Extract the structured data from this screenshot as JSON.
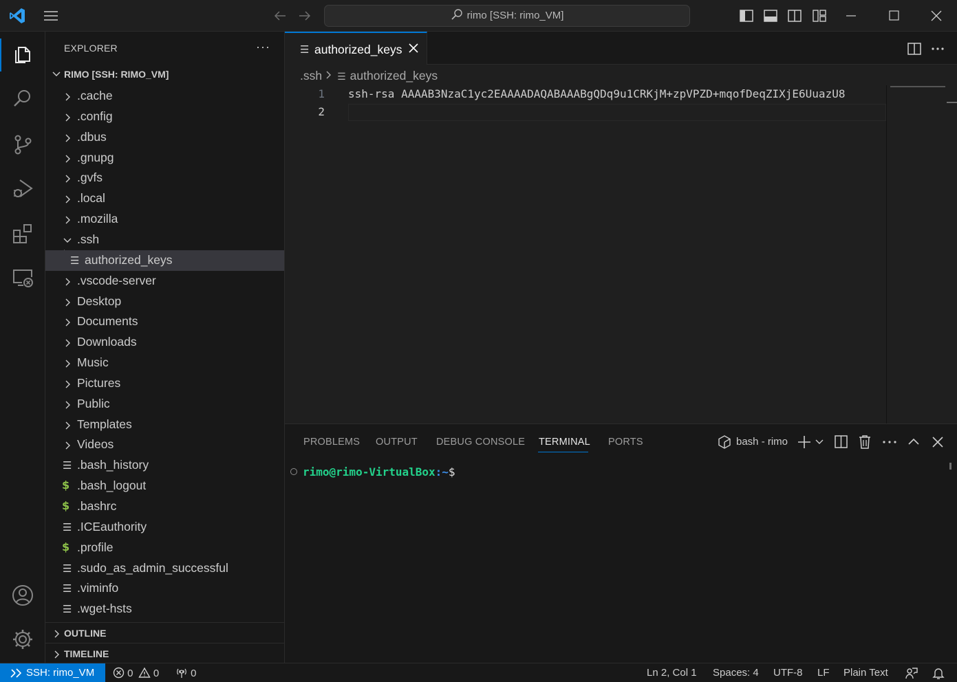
{
  "titlebar": {
    "search_text": "rimo [SSH: rimo_VM]",
    "icons": [
      "vscode-logo-icon",
      "menu-icon",
      "arrow-left-icon",
      "arrow-right-icon",
      "toggle-primary-sidebar-icon",
      "toggle-panel-icon",
      "toggle-secondary-sidebar-icon",
      "customize-layout-icon",
      "minimize-icon",
      "maximize-icon",
      "close-icon"
    ]
  },
  "activitybar": {
    "items": [
      "explorer-icon",
      "search-icon",
      "source-control-icon",
      "run-debug-icon",
      "extensions-icon",
      "remote-explorer-icon"
    ],
    "bottom": [
      "accounts-icon",
      "manage-gear-icon"
    ]
  },
  "sidebar": {
    "title": "EXPLORER",
    "more": "···",
    "root_label": "RIMO [SSH: RIMO_VM]",
    "tree": [
      {
        "label": ".cache",
        "type": "folder"
      },
      {
        "label": ".config",
        "type": "folder"
      },
      {
        "label": ".dbus",
        "type": "folder"
      },
      {
        "label": ".gnupg",
        "type": "folder"
      },
      {
        "label": ".gvfs",
        "type": "folder"
      },
      {
        "label": ".local",
        "type": "folder"
      },
      {
        "label": ".mozilla",
        "type": "folder"
      },
      {
        "label": ".ssh",
        "type": "folder-open"
      },
      {
        "label": "authorized_keys",
        "type": "file-child",
        "selected": true
      },
      {
        "label": ".vscode-server",
        "type": "folder"
      },
      {
        "label": "Desktop",
        "type": "folder"
      },
      {
        "label": "Documents",
        "type": "folder"
      },
      {
        "label": "Downloads",
        "type": "folder"
      },
      {
        "label": "Music",
        "type": "folder"
      },
      {
        "label": "Pictures",
        "type": "folder"
      },
      {
        "label": "Public",
        "type": "folder"
      },
      {
        "label": "Templates",
        "type": "folder"
      },
      {
        "label": "Videos",
        "type": "folder"
      },
      {
        "label": ".bash_history",
        "type": "file"
      },
      {
        "label": ".bash_logout",
        "type": "shell"
      },
      {
        "label": ".bashrc",
        "type": "shell"
      },
      {
        "label": ".ICEauthority",
        "type": "file"
      },
      {
        "label": ".profile",
        "type": "shell"
      },
      {
        "label": ".sudo_as_admin_successful",
        "type": "file"
      },
      {
        "label": ".viminfo",
        "type": "file"
      },
      {
        "label": ".wget-hsts",
        "type": "file"
      }
    ],
    "outline_label": "OUTLINE",
    "timeline_label": "TIMELINE"
  },
  "editor": {
    "tab_label": "authorized_keys",
    "breadcrumb_folder": ".ssh",
    "breadcrumb_file": "authorized_keys",
    "line_numbers": [
      "1",
      "2"
    ],
    "lines": [
      "ssh-rsa AAAAB3NzaC1yc2EAAAADAQABAAABgQDq9u1CRKjM+zpVPZD+mqofDeqZIXjE6UuazU8",
      ""
    ]
  },
  "panel": {
    "tabs": [
      "PROBLEMS",
      "OUTPUT",
      "DEBUG CONSOLE",
      "TERMINAL",
      "PORTS"
    ],
    "active_tab": "TERMINAL",
    "terminal_name": "bash - rimo",
    "prompt_user": "rimo@rimo-VirtualBox",
    "prompt_path": ":~",
    "prompt_symbol": "$"
  },
  "statusbar": {
    "remote": "SSH: rimo_VM",
    "errors": "0",
    "warnings": "0",
    "ports": "0",
    "position": "Ln 2, Col 1",
    "spaces": "Spaces: 4",
    "encoding": "UTF-8",
    "eol": "LF",
    "language": "Plain Text"
  },
  "colors": {
    "accent": "#0078d4",
    "background": "#1f1f1f",
    "sidebar": "#181818",
    "selection": "#37373d",
    "terminal_user": "#23d18b",
    "terminal_path": "#3b8eea",
    "shell_icon": "#8dc149"
  }
}
